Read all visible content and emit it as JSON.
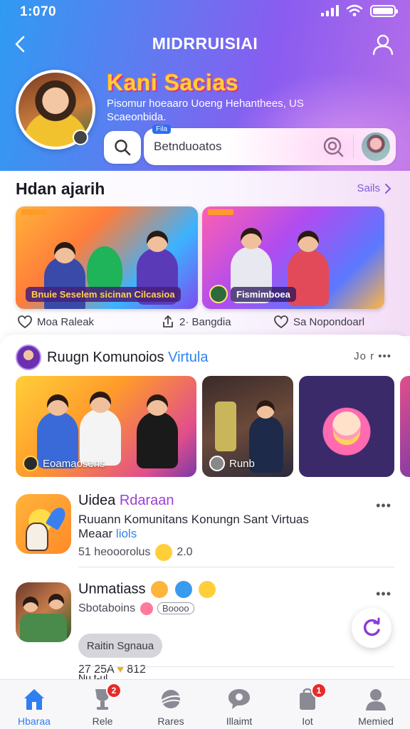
{
  "status_bar": {
    "time": "1:070"
  },
  "header": {
    "title": "MIDRRUISIAI",
    "brand_title": "Kani Sacias",
    "brand_subtitle": "Pisomur hoeaaro Uoeng Hehanthees, US Scaeonbida.",
    "search": {
      "tag": "Fila",
      "placeholder": "Betnduoatos"
    }
  },
  "section_highlights": {
    "title": "Hdan ajarih",
    "more_label": "Sails",
    "cards": [
      {
        "label": "Bnuie Seselem sicinan Cilcasioa"
      },
      {
        "label": "Fismimboea"
      }
    ],
    "stats": [
      {
        "icon": "heart-outline-icon",
        "text": "Moa Raleak"
      },
      {
        "icon": "share-icon",
        "text": "2· Bangdia"
      },
      {
        "icon": "heart-outline-icon",
        "text": "Sa Nopondoarl"
      }
    ]
  },
  "communities": {
    "title_main": "Ruugn Komunoios",
    "title_accent": "Virtula",
    "more_label": "Jo r •••",
    "tiles": [
      {
        "caption": "Eoamaosens"
      },
      {
        "caption": "Runb"
      },
      {
        "caption": ""
      }
    ],
    "items": [
      {
        "title_main": "Uidea",
        "title_accent": "Rdaraan",
        "desc_main": "Ruuann Komunitans Konungn Sant Virtuas",
        "desc_line2": "Meaar",
        "desc_line2_accent": "liols",
        "meta_left": "51 heooorolus",
        "meta_right": "2.0",
        "menu": "•••"
      },
      {
        "title_main": "Unmatiass",
        "subtitle": "Sbotaboins",
        "pill": "Boooo",
        "join_label": "Raitin Sgnaua",
        "stats_left": "27 25A",
        "stats_right": "812",
        "menu": "•••"
      }
    ],
    "peek_text": "Nu t-ul"
  },
  "bottom_nav": {
    "items": [
      {
        "label": "Hbaraa",
        "icon": "home-icon",
        "active": true,
        "badge": ""
      },
      {
        "label": "Rele",
        "icon": "trophy-icon",
        "active": false,
        "badge": "2"
      },
      {
        "label": "Rares",
        "icon": "planet-icon",
        "active": false,
        "badge": ""
      },
      {
        "label": "Illaimt",
        "icon": "chat-bubble-icon",
        "active": false,
        "badge": ""
      },
      {
        "label": "Iot",
        "icon": "bag-icon",
        "active": false,
        "badge": "1"
      },
      {
        "label": "Memied",
        "icon": "person-icon",
        "active": false,
        "badge": ""
      }
    ]
  },
  "colors": {
    "header_gradient_start": "#2f9bf2",
    "header_gradient_end": "#b56ee8",
    "accent_blue": "#2e84ee",
    "accent_purple": "#9b3fd8",
    "active_nav": "#2e7ff0",
    "badge_red": "#e82a2a"
  }
}
